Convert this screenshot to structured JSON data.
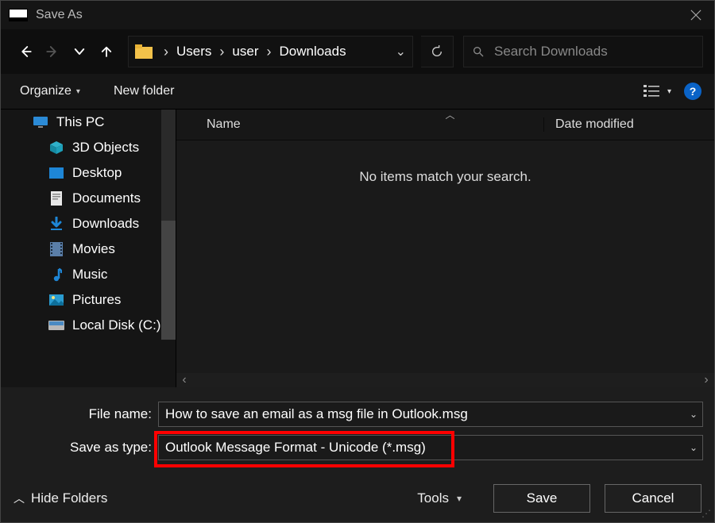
{
  "title": "Save As",
  "breadcrumbs": [
    "Users",
    "user",
    "Downloads"
  ],
  "search_placeholder": "Search Downloads",
  "toolbar": {
    "organize": "Organize",
    "newfolder": "New folder"
  },
  "columns": {
    "name": "Name",
    "date": "Date modified"
  },
  "empty_msg": "No items match your search.",
  "tree": {
    "root": "This PC",
    "items": [
      "3D Objects",
      "Desktop",
      "Documents",
      "Downloads",
      "Movies",
      "Music",
      "Pictures",
      "Local Disk (C:)"
    ]
  },
  "form": {
    "filename_label": "File name:",
    "filename_value": "How to save an email as a msg file in Outlook.msg",
    "type_label": "Save as type:",
    "type_value": "Outlook Message Format - Unicode (*.msg)"
  },
  "footer": {
    "hide": "Hide Folders",
    "tools": "Tools",
    "save": "Save",
    "cancel": "Cancel"
  }
}
